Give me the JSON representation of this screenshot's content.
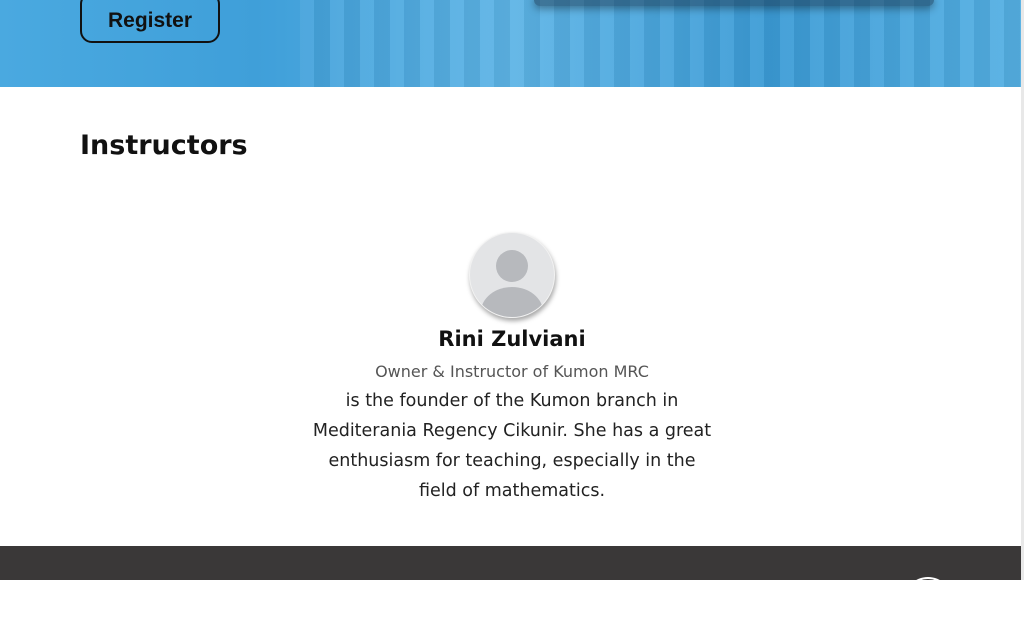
{
  "hero": {
    "register_label": "Register"
  },
  "instructors": {
    "title": "Instructors",
    "items": [
      {
        "name": "Rini Zulviani",
        "role": "Owner & Instructor of Kumon MRC",
        "bio": "is the founder of the Kumon branch in Mediterania Regency Cikunir. She has a great enthusiasm for teaching, especially in the field of mathematics."
      }
    ]
  },
  "colors": {
    "hero_blue": "#4aa9e0",
    "footer_dark": "#3a3838"
  }
}
